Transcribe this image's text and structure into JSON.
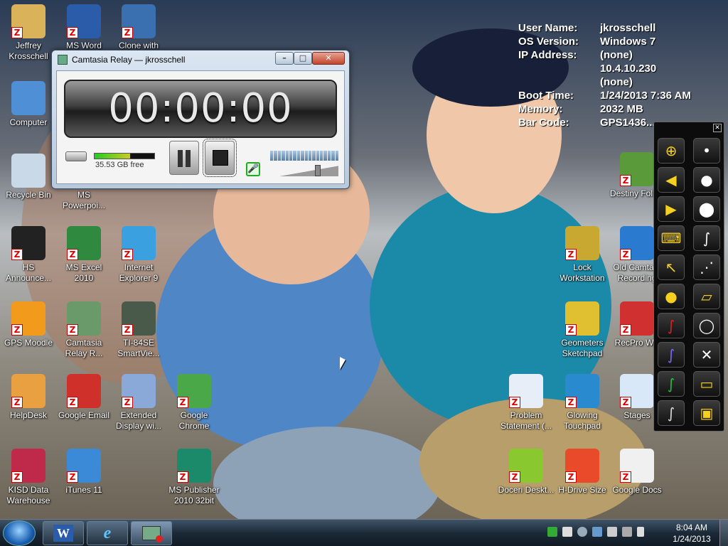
{
  "desktop_icons": [
    {
      "id": "jeffrey",
      "label": "Jeffrey Krosschell",
      "icon": "user-folder-icon"
    },
    {
      "id": "msword",
      "label": "MS Word",
      "icon": "word-icon"
    },
    {
      "id": "clonewith",
      "label": "Clone with",
      "icon": "windows-clone-icon"
    },
    {
      "id": "computer",
      "label": "Computer",
      "icon": "computer-icon"
    },
    {
      "id": "recycle",
      "label": "Recycle Bin",
      "icon": "recycle-bin-icon"
    },
    {
      "id": "mspowerpoint",
      "label": "MS Powerpoi...",
      "icon": "powerpoint-icon"
    },
    {
      "id": "hsannounce",
      "label": "HS Announce...",
      "icon": "announcement-icon"
    },
    {
      "id": "msexcel",
      "label": "MS Excel 2010",
      "icon": "excel-icon"
    },
    {
      "id": "ie9",
      "label": "Internet Explorer 9",
      "icon": "internet-explorer-icon"
    },
    {
      "id": "gpsmoodle",
      "label": "GPS Moodle",
      "icon": "moodle-icon"
    },
    {
      "id": "camrelay",
      "label": "Camtasia Relay R...",
      "icon": "camtasia-relay-icon"
    },
    {
      "id": "ti84",
      "label": "TI-84SE SmartVie...",
      "icon": "ti84-calculator-icon"
    },
    {
      "id": "helpdesk",
      "label": "HelpDesk",
      "icon": "lifebuoy-icon"
    },
    {
      "id": "googleemail",
      "label": "Google Email",
      "icon": "gmail-icon"
    },
    {
      "id": "extdisplay",
      "label": "Extended Display wi...",
      "icon": "extended-display-icon"
    },
    {
      "id": "chrome",
      "label": "Google Chrome",
      "icon": "chrome-icon"
    },
    {
      "id": "kisd",
      "label": "KISD Data Warehouse",
      "icon": "kisd-data-icon"
    },
    {
      "id": "itunes",
      "label": "iTunes 11",
      "icon": "itunes-icon"
    },
    {
      "id": "mspublisher",
      "label": "MS Publisher 2010 32bit",
      "icon": "publisher-icon"
    },
    {
      "id": "destiny",
      "label": "Destiny Follett",
      "icon": "destiny-tree-icon"
    },
    {
      "id": "lockws",
      "label": "Lock Workstation",
      "icon": "padlock-icon"
    },
    {
      "id": "oldcamtasia",
      "label": "Old Camta... Recording",
      "icon": "old-camtasia-icon"
    },
    {
      "id": "geometers",
      "label": "Geometers Sketchpad",
      "icon": "geometers-sketchpad-icon"
    },
    {
      "id": "recpro",
      "label": "RecPro WE",
      "icon": "recpro-icon"
    },
    {
      "id": "problem",
      "label": "Problem Statement (...",
      "icon": "word-document-icon"
    },
    {
      "id": "glowing",
      "label": "Glowing Touchpad",
      "icon": "touchpad-icon"
    },
    {
      "id": "stages",
      "label": "Stages",
      "icon": "stages-icon"
    },
    {
      "id": "doceri",
      "label": "Doceri Deskt...",
      "icon": "doceri-hand-icon"
    },
    {
      "id": "hdrive",
      "label": "H-Drive Size",
      "icon": "pie-chart-icon"
    },
    {
      "id": "googledocs",
      "label": "Google Docs",
      "icon": "google-docs-icon"
    }
  ],
  "bginfo": {
    "rows": [
      {
        "key": "User Name:",
        "value": "jkrosschell"
      },
      {
        "key": "OS Version:",
        "value": "Windows 7"
      },
      {
        "key": "IP Address:",
        "value": "(none)"
      },
      {
        "key": "",
        "value": "10.4.10.230"
      },
      {
        "key": "",
        "value": "(none)"
      },
      {
        "key": "Boot Time:",
        "value": "1/24/2013 7:36 AM"
      },
      {
        "key": "Memory:",
        "value": "2032 MB"
      },
      {
        "key": "Bar Code:",
        "value": "GPS1436..."
      }
    ]
  },
  "camtasia": {
    "title": "Camtasia Relay — jkrosschell",
    "timer": "00:00:00",
    "free_space": "35.53 GB free",
    "input_level": 0.6,
    "volume_level": 0.72,
    "window_buttons": {
      "minimize": "–",
      "maximize": "□",
      "close": "✕"
    },
    "mic_glyph": "🎤"
  },
  "pen_toolbar": {
    "close": "✕",
    "left_tools": [
      "zoom-pointer-icon",
      "arrow-left-icon",
      "arrow-right-icon",
      "keyboard-icon",
      "pen-select-icon",
      "palette-icon",
      "red-pen-icon",
      "purple-pen-icon",
      "green-pen-icon",
      "black-pen-icon"
    ],
    "right_tools": [
      "small-dot-icon",
      "medium-dot-icon",
      "large-dot-icon",
      "stroke-thin-icon",
      "stroke-dashed-icon",
      "eraser-icon",
      "lasso-icon",
      "clear-icon",
      "print-icon",
      "save-icon"
    ]
  },
  "taskbar": {
    "apps": [
      "word-icon",
      "internet-explorer-icon",
      "camtasia-relay-icon"
    ],
    "clock_time": "8:04 AM",
    "clock_date": "1/24/2013"
  },
  "colors": {
    "zbadge": "#dd0000",
    "timer_text": "#e8e8e8"
  }
}
